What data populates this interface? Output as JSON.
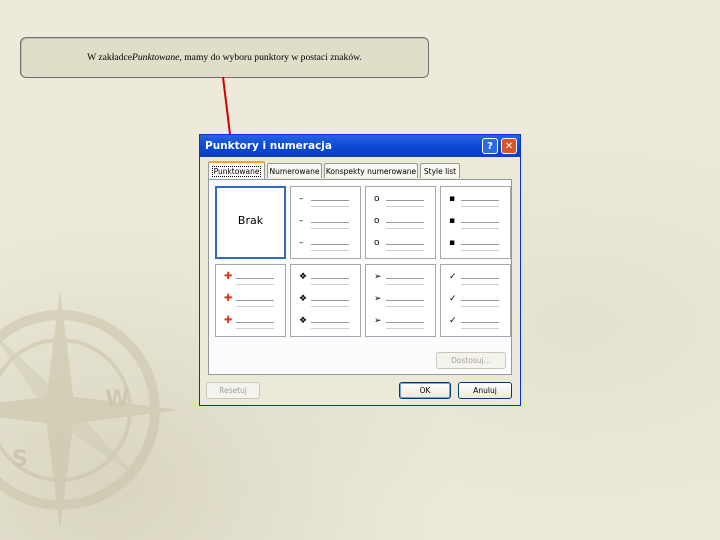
{
  "callout": {
    "prefix": "W zakładce ",
    "tab_ref": "Punktowane",
    "suffix": ", mamy do wyboru punktory w postaci znaków."
  },
  "dialog": {
    "title": "Punktory i numeracja",
    "help_icon": "question-icon",
    "close_icon": "close-icon",
    "tabs": [
      {
        "label": "Punktowane",
        "active": true
      },
      {
        "label": "Numerowane",
        "active": false
      },
      {
        "label": "Konspekty numerowane",
        "active": false
      },
      {
        "label": "Style list",
        "active": false
      }
    ],
    "grid": {
      "none_label": "Brak",
      "row1": [
        {
          "glyph": ""
        },
        {
          "glyph": "–"
        },
        {
          "glyph": "o"
        },
        {
          "glyph": "▪"
        }
      ],
      "row2": [
        {
          "glyph": "✚"
        },
        {
          "glyph": "❖"
        },
        {
          "glyph": "➢"
        },
        {
          "glyph": "✓"
        }
      ]
    },
    "buttons": {
      "customize": "Dostosuj...",
      "reset": "Resetuj",
      "ok": "OK",
      "cancel": "Anuluj"
    }
  },
  "colors": {
    "arrow": "#d40000",
    "titlebar": "#0b4ad4",
    "selection": "#316ac5",
    "tab_highlight": "#f5a623"
  }
}
